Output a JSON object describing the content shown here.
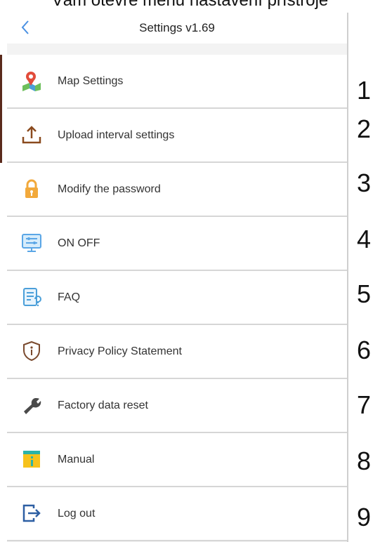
{
  "caption": "Vám otevře menu nastavení přístroje",
  "header": {
    "title": "Settings v1.69"
  },
  "menu": [
    {
      "label": "Map Settings",
      "icon": "map-pin-icon",
      "number": "1"
    },
    {
      "label": "Upload interval settings",
      "icon": "upload-icon",
      "number": "2"
    },
    {
      "label": "Modify the password",
      "icon": "lock-icon",
      "number": "3"
    },
    {
      "label": "ON OFF",
      "icon": "monitor-toggle-icon",
      "number": "4"
    },
    {
      "label": "FAQ",
      "icon": "faq-document-icon",
      "number": "5"
    },
    {
      "label": "Privacy Policy Statement",
      "icon": "shield-info-icon",
      "number": "6"
    },
    {
      "label": "Factory data reset",
      "icon": "wrench-icon",
      "number": "7"
    },
    {
      "label": "Manual",
      "icon": "manual-book-icon",
      "number": "8"
    },
    {
      "label": "Log out",
      "icon": "logout-icon",
      "number": "9"
    }
  ],
  "colors": {
    "back_arrow": "#4a90e2",
    "pin": "#e24c3b",
    "upload": "#8a4a1e",
    "lock": "#f2a93b",
    "monitor": "#5aa6e6",
    "shield": "#7a4a2e",
    "manual_yellow": "#f6c21c",
    "manual_teal": "#2bb3a8",
    "logout": "#2d5fa3"
  }
}
